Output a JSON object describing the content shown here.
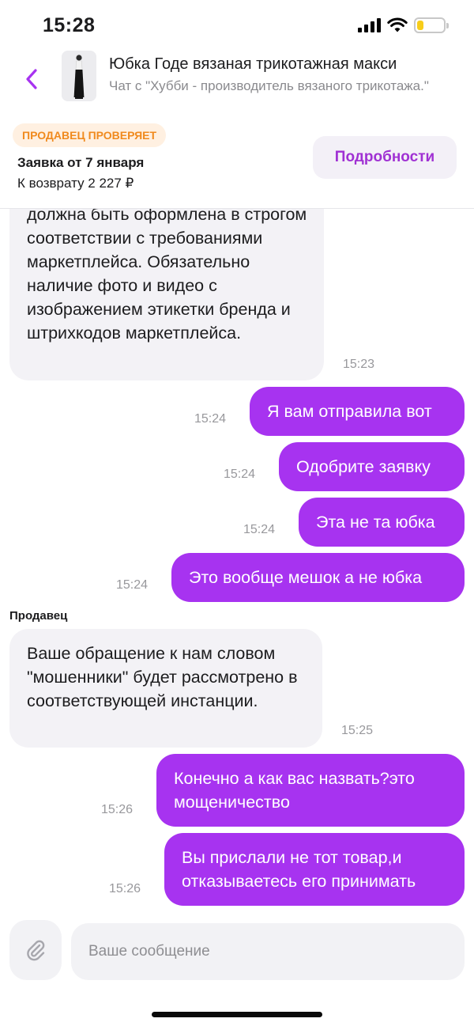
{
  "status_bar": {
    "time": "15:28",
    "battery_level": 0.25
  },
  "header": {
    "title": "Юбка Годе вязаная трикотажная макси",
    "subtitle": "Чат с \"Хубби - производитель вязаного трикотажа.\""
  },
  "order": {
    "status_badge": "ПРОДАВЕЦ ПРОВЕРЯЕТ",
    "date": "Заявка от 7 января",
    "refund": "К возврату 2 227 ₽",
    "details_label": "Подробности"
  },
  "messages": [
    {
      "text": "должна быть оформлена в строгом соответствии с требованиями маркетплейса. Обязательно наличие фото и видео с изображением этикетки бренда и штрихкодов маркетплейса.",
      "time": "15:23"
    },
    {
      "text": "Я вам отправила вот",
      "time": "15:24"
    },
    {
      "text": "Одобрите заявку",
      "time": "15:24"
    },
    {
      "text": "Эта не та юбка",
      "time": "15:24"
    },
    {
      "text": "Это вообще мешок а не юбка",
      "time": "15:24"
    },
    {
      "text": "Ваше обращение к нам словом \"мошенники\" будет рассмотрено в соответствующей инстанции.",
      "time": "15:25"
    },
    {
      "text": "Конечно а как вас назвать?это мощеничество",
      "time": "15:26"
    },
    {
      "text": "Вы прислали не тот товар,и отказываетесь его принимать",
      "time": "15:26"
    }
  ],
  "sender_label": "Продавец",
  "composer": {
    "placeholder": "Ваше сообщение"
  },
  "colors": {
    "accent": "#a733f0",
    "accent_text": "#a031d3",
    "badge_bg": "#fff0e1",
    "badge_text": "#f08a1e"
  }
}
